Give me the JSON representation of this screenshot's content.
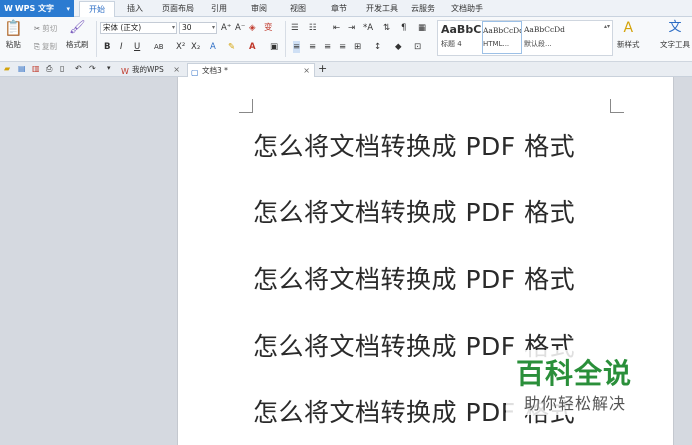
{
  "app": {
    "title": "WPS 文字",
    "logo": "W"
  },
  "menu": {
    "tabs": [
      "开始",
      "插入",
      "页面布局",
      "引用",
      "审阅",
      "视图",
      "章节",
      "开发工具",
      "云服务",
      "文档助手"
    ],
    "active": "开始"
  },
  "ribbon": {
    "paste": "粘贴",
    "cut": "剪切",
    "copy": "复制",
    "format_painter": "格式刷",
    "font_name": "宋体 (正文)",
    "font_size": "30",
    "styles": [
      {
        "sample": "AaBbC",
        "label": "标题 4"
      },
      {
        "sample": "AaBbCcDd",
        "label": "HTML..."
      },
      {
        "sample": "AaBbCcDd",
        "label": "默认段..."
      }
    ],
    "new_style": "新样式",
    "text_tools": "文字工具"
  },
  "tabbar": {
    "tabs": [
      {
        "label": "我的WPS",
        "icon": "wps-icon"
      },
      {
        "label": "文档3 *",
        "icon": "document-icon"
      }
    ],
    "add": "+"
  },
  "document": {
    "lines": [
      "怎么将文档转换成 PDF 格式",
      "怎么将文档转换成 PDF 格式",
      "怎么将文档转换成 PDF 格式",
      "怎么将文档转换成 PDF 格式",
      "怎么将文档转换成 PDF 格式"
    ]
  },
  "watermark": {
    "title": "百科全说",
    "subtitle": "助你轻松解决"
  },
  "colors": {
    "accent": "#2b7bd1",
    "watermark_green": "#2a8f3a"
  }
}
